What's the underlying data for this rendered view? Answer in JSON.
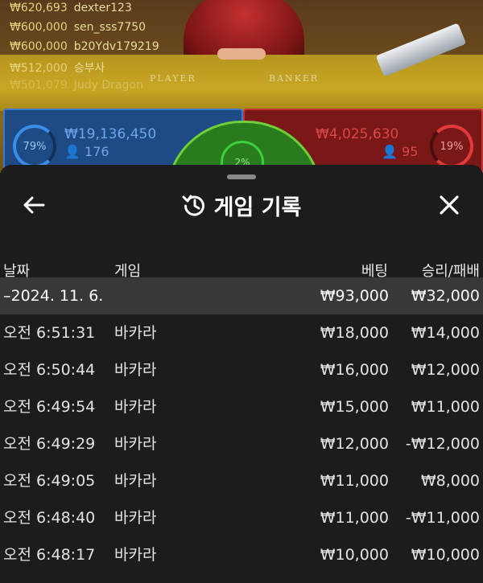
{
  "background": {
    "bettors": [
      {
        "amount": "₩620,693",
        "name": "dexter123"
      },
      {
        "amount": "₩600,000",
        "name": "sen_sss7750"
      },
      {
        "amount": "₩600,000",
        "name": "b20Ydv179219"
      },
      {
        "amount": "₩512,000",
        "name": "승부사"
      },
      {
        "amount": "₩501,079",
        "name": "Judy Dragon"
      }
    ],
    "table_labels": {
      "player": "PLAYER",
      "banker": "BANKER"
    },
    "player_panel": {
      "percent": "79%",
      "amount": "₩19,136,450",
      "count": "176"
    },
    "banker_panel": {
      "percent": "19%",
      "amount": "₩4,025,630",
      "count": "95"
    },
    "tie_panel": {
      "percent": "2%"
    },
    "colors": {
      "player": "#1e4a86",
      "banker": "#7a1818",
      "tie": "#2a7a1e"
    }
  },
  "sheet": {
    "title": "게임 기록",
    "icons": {
      "back": "back-arrow-icon",
      "history": "history-icon",
      "close": "close-icon"
    },
    "columns": {
      "date": "날짜",
      "game": "게임",
      "bet": "베팅",
      "win_loss": "승리/패배"
    },
    "summary": {
      "date": "–2024. 11. 6.",
      "bet": "₩93,000",
      "win_loss": "₩32,000"
    },
    "rows": [
      {
        "time": "오전 6:51:31",
        "game": "바카라",
        "bet": "₩18,000",
        "win_loss": "₩14,000"
      },
      {
        "time": "오전 6:50:44",
        "game": "바카라",
        "bet": "₩16,000",
        "win_loss": "₩12,000"
      },
      {
        "time": "오전 6:49:54",
        "game": "바카라",
        "bet": "₩15,000",
        "win_loss": "₩11,000"
      },
      {
        "time": "오전 6:49:29",
        "game": "바카라",
        "bet": "₩12,000",
        "win_loss": "-₩12,000"
      },
      {
        "time": "오전 6:49:05",
        "game": "바카라",
        "bet": "₩11,000",
        "win_loss": "₩8,000"
      },
      {
        "time": "오전 6:48:40",
        "game": "바카라",
        "bet": "₩11,000",
        "win_loss": "-₩11,000"
      },
      {
        "time": "오전 6:48:17",
        "game": "바카라",
        "bet": "₩10,000",
        "win_loss": "₩10,000"
      }
    ]
  }
}
